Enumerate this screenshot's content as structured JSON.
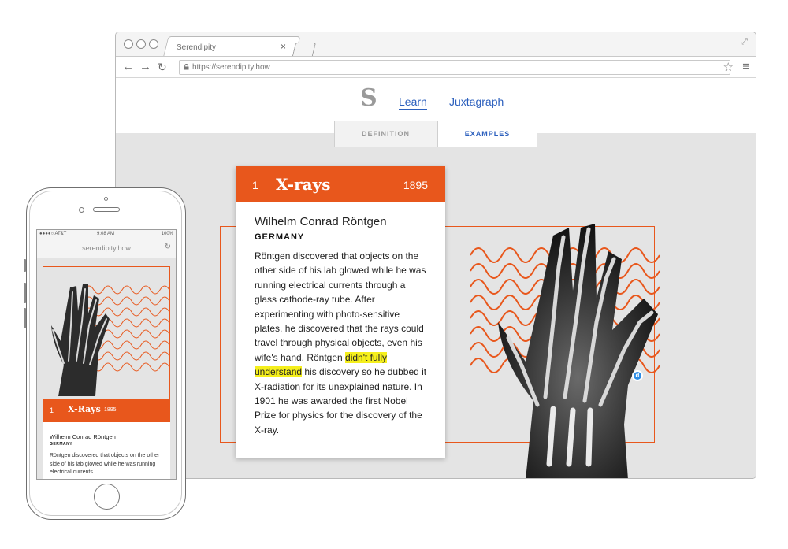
{
  "browser": {
    "tab_title": "Serendipity",
    "tab_close": "×",
    "url": "https://serendipity.how",
    "back_icon": "arrow-left",
    "forward_icon": "arrow-right",
    "reload_icon": "reload",
    "star_icon": "star",
    "menu_icon": "hamburger"
  },
  "site": {
    "logo": "S",
    "nav": {
      "learn": "Learn",
      "juxtagraph": "Juxtagraph"
    },
    "tabs": {
      "definition": "DEFINITION",
      "examples": "EXAMPLES"
    },
    "accent": "#e8571c",
    "link_color": "#2b5fbd"
  },
  "card": {
    "number": "1",
    "title": "X-rays",
    "year": "1895",
    "name": "Wilhelm Conrad Röntgen",
    "country": "GERMANY",
    "body_before": "Röntgen discovered that objects on the other side of his lab glowed while he was running electrical currents through a glass cathode-ray tube. After experimenting with photo-sensitive plates, he discovered that the rays could travel through physical objects, even his wife's hand. Röntgen ",
    "body_highlight": "didn't fully understand",
    "body_after": " his discovery so he dubbed it X-radiation for its unexplained nature. In 1901 he was awarded the first Nobel Prize for physics for the discovery of the X-ray.",
    "highlight_color": "#f5ef1c",
    "badge": "d"
  },
  "mobile": {
    "status_carrier": "●●●●○ AT&T ",
    "status_time": "9:08 AM",
    "status_battery": "100%",
    "url": "serendipity.how",
    "reload": "↻",
    "card_number": "1",
    "card_title": "X-Rays",
    "card_year": "1895",
    "card_name": "Wilhelm Conrad Röntgen",
    "card_country": "GERMANY",
    "card_body": "Röntgen discovered that objects on the other side of his lab glowed while he was running electrical currents"
  }
}
